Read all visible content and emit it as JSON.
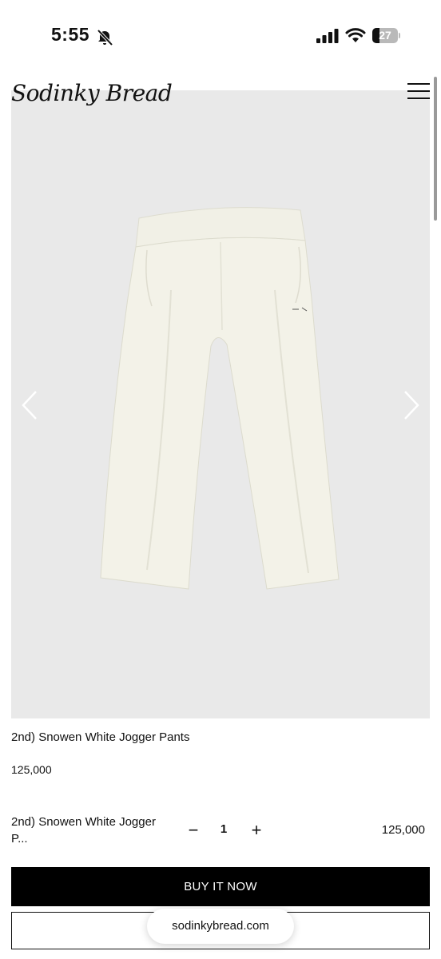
{
  "status_bar": {
    "time": "5:55",
    "battery_level": "27",
    "battery_fraction": 0.27
  },
  "header": {
    "logo_text": "Sodinky Bread"
  },
  "product": {
    "title": "2nd) Snowen White Jogger Pants",
    "price": "125,000",
    "image_bg_color": "#e9e9e9",
    "image_content": "White jogger pants photo"
  },
  "cart_row": {
    "name_line1": "2nd) Snowen White Jogger",
    "name_line2": "P...",
    "minus_label": "−",
    "quantity": "1",
    "plus_label": "+",
    "price": "125,000"
  },
  "buttons": {
    "buy_label": "BUY IT NOW"
  },
  "browser": {
    "url": "sodinkybread.com"
  },
  "icons": [
    "bell-slash-icon",
    "cellular-signal-icon",
    "wifi-icon",
    "battery-icon",
    "hamburger-menu-icon",
    "chevron-left-icon",
    "chevron-right-icon"
  ]
}
